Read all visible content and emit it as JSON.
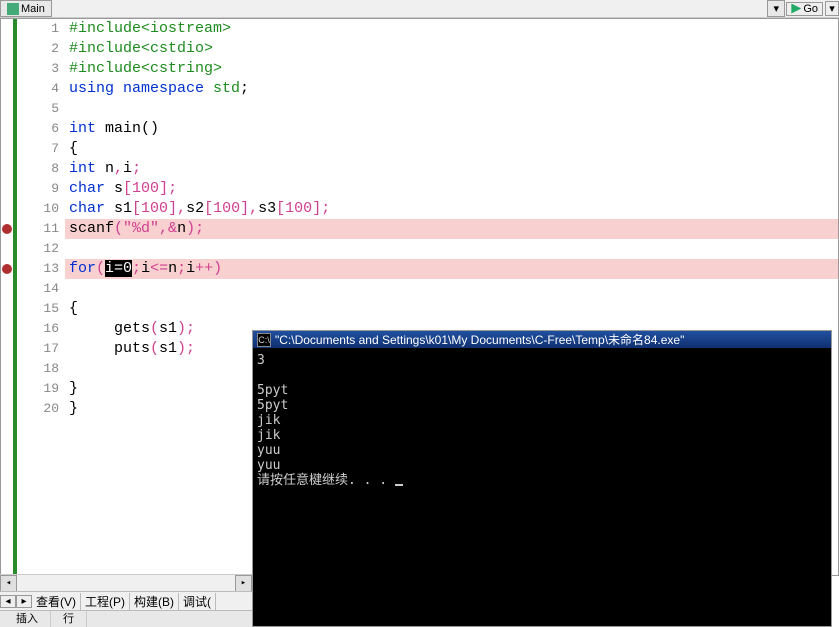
{
  "top_tab": {
    "label": "Main"
  },
  "top_right": {
    "go": "Go"
  },
  "code": {
    "lines": [
      {
        "n": "1",
        "parts": [
          {
            "t": "#include",
            "c": "preproc"
          },
          {
            "t": "<iostream>",
            "c": "preproc"
          }
        ]
      },
      {
        "n": "2",
        "parts": [
          {
            "t": "#include",
            "c": "preproc"
          },
          {
            "t": "<cstdio>",
            "c": "preproc"
          }
        ]
      },
      {
        "n": "3",
        "parts": [
          {
            "t": "#include",
            "c": "preproc"
          },
          {
            "t": "<cstring>",
            "c": "preproc"
          }
        ]
      },
      {
        "n": "4",
        "parts": [
          {
            "t": "using ",
            "c": "kw-blue"
          },
          {
            "t": "namespace ",
            "c": "kw-blue"
          },
          {
            "t": "std",
            "c": "kw-green"
          },
          {
            "t": ";",
            "c": "black"
          }
        ]
      },
      {
        "n": "5",
        "parts": []
      },
      {
        "n": "6",
        "parts": [
          {
            "t": "int ",
            "c": "kw-blue"
          },
          {
            "t": "main",
            "c": "black"
          },
          {
            "t": "()",
            "c": "black"
          }
        ]
      },
      {
        "n": "7",
        "parts": [
          {
            "t": "{",
            "c": "black"
          }
        ]
      },
      {
        "n": "8",
        "parts": [
          {
            "t": "int ",
            "c": "kw-blue"
          },
          {
            "t": "n",
            "c": "black"
          },
          {
            "t": ",",
            "c": "punct"
          },
          {
            "t": "i",
            "c": "black"
          },
          {
            "t": ";",
            "c": "punct"
          }
        ]
      },
      {
        "n": "9",
        "parts": [
          {
            "t": "char ",
            "c": "kw-blue"
          },
          {
            "t": "s",
            "c": "black"
          },
          {
            "t": "[",
            "c": "punct"
          },
          {
            "t": "100",
            "c": "num-pink"
          },
          {
            "t": "];",
            "c": "punct"
          }
        ]
      },
      {
        "n": "10",
        "parts": [
          {
            "t": "char ",
            "c": "kw-blue"
          },
          {
            "t": "s1",
            "c": "black"
          },
          {
            "t": "[",
            "c": "punct"
          },
          {
            "t": "100",
            "c": "num-pink"
          },
          {
            "t": "],",
            "c": "punct"
          },
          {
            "t": "s2",
            "c": "black"
          },
          {
            "t": "[",
            "c": "punct"
          },
          {
            "t": "100",
            "c": "num-pink"
          },
          {
            "t": "],",
            "c": "punct"
          },
          {
            "t": "s3",
            "c": "black"
          },
          {
            "t": "[",
            "c": "punct"
          },
          {
            "t": "100",
            "c": "num-pink"
          },
          {
            "t": "];",
            "c": "punct"
          }
        ]
      },
      {
        "n": "11",
        "hl": true,
        "bp": true,
        "parts": [
          {
            "t": "scanf",
            "c": "black"
          },
          {
            "t": "(",
            "c": "punct"
          },
          {
            "t": "\"%d\"",
            "c": "str-pink"
          },
          {
            "t": ",&",
            "c": "punct"
          },
          {
            "t": "n",
            "c": "black"
          },
          {
            "t": ");",
            "c": "punct"
          }
        ]
      },
      {
        "n": "12",
        "parts": []
      },
      {
        "n": "13",
        "hl": true,
        "bp": true,
        "parts": [
          {
            "t": "for",
            "c": "kw-blue"
          },
          {
            "t": "(",
            "c": "punct"
          },
          {
            "t": "i=0",
            "sel": true
          },
          {
            "t": ";",
            "c": "punct"
          },
          {
            "t": "i",
            "c": "black"
          },
          {
            "t": "<=",
            "c": "punct"
          },
          {
            "t": "n",
            "c": "black"
          },
          {
            "t": ";",
            "c": "punct"
          },
          {
            "t": "i",
            "c": "black"
          },
          {
            "t": "++)",
            "c": "punct"
          }
        ]
      },
      {
        "n": "14",
        "parts": []
      },
      {
        "n": "15",
        "parts": [
          {
            "t": "{",
            "c": "black"
          }
        ]
      },
      {
        "n": "16",
        "parts": [
          {
            "t": "     gets",
            "c": "black"
          },
          {
            "t": "(",
            "c": "punct"
          },
          {
            "t": "s1",
            "c": "black"
          },
          {
            "t": ");",
            "c": "punct"
          }
        ]
      },
      {
        "n": "17",
        "parts": [
          {
            "t": "     puts",
            "c": "black"
          },
          {
            "t": "(",
            "c": "punct"
          },
          {
            "t": "s1",
            "c": "black"
          },
          {
            "t": ");",
            "c": "punct"
          }
        ]
      },
      {
        "n": "18",
        "parts": []
      },
      {
        "n": "19",
        "parts": [
          {
            "t": "}",
            "c": "black"
          }
        ]
      },
      {
        "n": "20",
        "parts": [
          {
            "t": "}",
            "c": "black"
          }
        ]
      }
    ]
  },
  "console": {
    "title_icon": "C:\\",
    "title": "\"C:\\Documents and Settings\\k01\\My Documents\\C-Free\\Temp\\未命名84.exe\"",
    "lines": [
      "3",
      "",
      "5pyt",
      "5pyt",
      "jik",
      "jik",
      "yuu",
      "yuu",
      "请按任意楗继续. . . "
    ]
  },
  "bottom_tabs": {
    "t1": "查看(V)",
    "t2": "工程(P)",
    "t3": "构建(B)",
    "t4": "调试("
  },
  "status": {
    "s1": "插入",
    "s2": "行"
  }
}
